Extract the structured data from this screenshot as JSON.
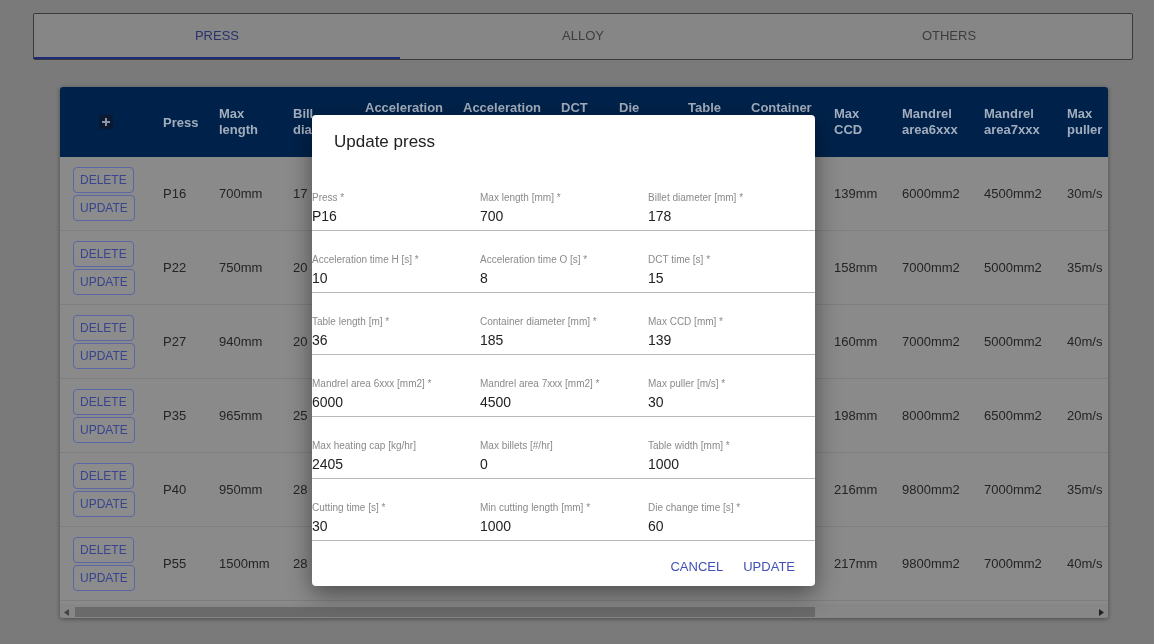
{
  "tabs": [
    {
      "label": "PRESS",
      "selected": true
    },
    {
      "label": "ALLOY",
      "selected": false
    },
    {
      "label": "OTHERS",
      "selected": false
    }
  ],
  "table": {
    "columns": [
      {
        "lines": [
          "Press"
        ]
      },
      {
        "lines": [
          "Max",
          "length"
        ]
      },
      {
        "lines": [
          "Bill",
          "dia"
        ]
      },
      {
        "lines": [
          "Acceleration"
        ]
      },
      {
        "lines": [
          "Acceleration"
        ]
      },
      {
        "lines": [
          "DCT"
        ]
      },
      {
        "lines": [
          "Die"
        ]
      },
      {
        "lines": [
          "Table"
        ]
      },
      {
        "lines": [
          "Container"
        ]
      },
      {
        "lines": [
          "Max",
          "CCD"
        ]
      },
      {
        "lines": [
          "Mandrel",
          "area6xxx"
        ]
      },
      {
        "lines": [
          "Mandrel",
          "area7xxx"
        ]
      },
      {
        "lines": [
          "Max",
          "puller"
        ]
      }
    ],
    "rows": [
      {
        "actions": [
          "DELETE",
          "UPDATE"
        ],
        "cells": [
          "P16",
          "700mm",
          "17",
          null,
          null,
          null,
          null,
          null,
          null,
          "139mm",
          "6000mm2",
          "4500mm2",
          "30m/s"
        ]
      },
      {
        "actions": [
          "DELETE",
          "UPDATE"
        ],
        "cells": [
          "P22",
          "750mm",
          "20",
          null,
          null,
          null,
          null,
          null,
          null,
          "158mm",
          "7000mm2",
          "5000mm2",
          "35m/s"
        ]
      },
      {
        "actions": [
          "DELETE",
          "UPDATE"
        ],
        "cells": [
          "P27",
          "940mm",
          "20",
          null,
          null,
          null,
          null,
          null,
          null,
          "160mm",
          "7000mm2",
          "5000mm2",
          "40m/s"
        ]
      },
      {
        "actions": [
          "DELETE",
          "UPDATE"
        ],
        "cells": [
          "P35",
          "965mm",
          "25",
          null,
          null,
          null,
          null,
          null,
          null,
          "198mm",
          "8000mm2",
          "6500mm2",
          "20m/s"
        ]
      },
      {
        "actions": [
          "DELETE",
          "UPDATE"
        ],
        "cells": [
          "P40",
          "950mm",
          "28",
          null,
          null,
          null,
          null,
          null,
          null,
          "216mm",
          "9800mm2",
          "7000mm2",
          "35m/s"
        ]
      },
      {
        "actions": [
          "DELETE",
          "UPDATE"
        ],
        "cells": [
          "P55",
          "1500mm",
          "28",
          null,
          null,
          null,
          null,
          null,
          null,
          "217mm",
          "9800mm2",
          "7000mm2",
          "40m/s"
        ]
      }
    ]
  },
  "dialog": {
    "title": "Update press",
    "fields": [
      {
        "label": "Press *",
        "value": "P16"
      },
      {
        "label": "Max length [mm] *",
        "value": "700"
      },
      {
        "label": "Billet diameter [mm] *",
        "value": "178"
      },
      {
        "label": "Acceleration time H [s] *",
        "value": "10"
      },
      {
        "label": "Acceleration time O [s] *",
        "value": "8"
      },
      {
        "label": "DCT time [s] *",
        "value": "15"
      },
      {
        "label": "Table length [m] *",
        "value": "36"
      },
      {
        "label": "Container diameter [mm] *",
        "value": "185"
      },
      {
        "label": "Max CCD [mm] *",
        "value": "139"
      },
      {
        "label": "Mandrel area 6xxx [mm2] *",
        "value": "6000"
      },
      {
        "label": "Mandrel area 7xxx [mm2] *",
        "value": "4500"
      },
      {
        "label": "Max puller [m/s] *",
        "value": "30"
      },
      {
        "label": "Max heating cap [kg/hr]",
        "value": "2405"
      },
      {
        "label": "Max billets [#/hr]",
        "value": "0"
      },
      {
        "label": "Table width [mm] *",
        "value": "1000"
      },
      {
        "label": "Cutting time [s] *",
        "value": "30"
      },
      {
        "label": "Min cutting length [mm] *",
        "value": "1000"
      },
      {
        "label": "Die change time [s] *",
        "value": "60"
      }
    ],
    "actions": [
      "CANCEL",
      "UPDATE"
    ]
  }
}
